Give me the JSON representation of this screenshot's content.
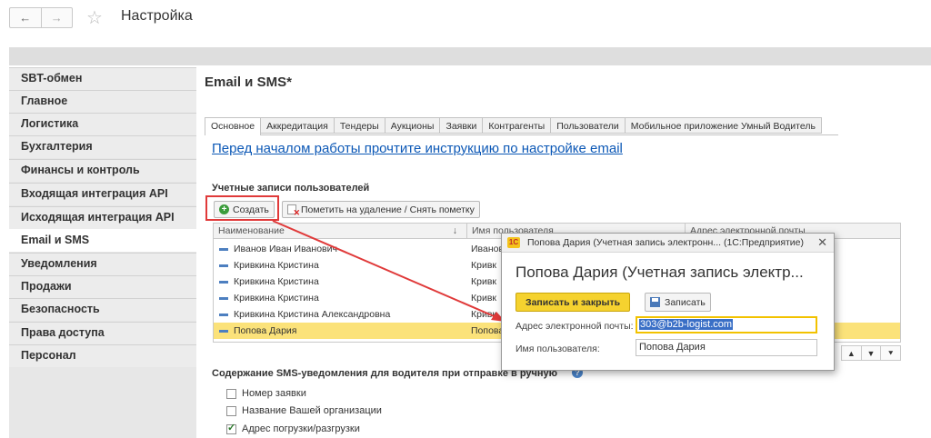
{
  "header": {
    "title": "Настройка",
    "back_glyph": "←",
    "forward_glyph": "→",
    "favorite_glyph": "☆"
  },
  "sidebar": {
    "items": [
      {
        "label": "SBT-обмен"
      },
      {
        "label": "Главное"
      },
      {
        "label": "Логистика"
      },
      {
        "label": "Бухгалтерия"
      },
      {
        "label": "Финансы и контроль"
      },
      {
        "label": "Входящая интеграция API"
      },
      {
        "label": "Исходящая интеграция API"
      },
      {
        "label": "Email и SMS",
        "active": true
      },
      {
        "label": "Уведомления"
      },
      {
        "label": "Продажи"
      },
      {
        "label": "Безопасность"
      },
      {
        "label": "Права доступа"
      },
      {
        "label": "Персонал"
      }
    ]
  },
  "main": {
    "title": "Email и SMS*",
    "tabs": [
      "Основное",
      "Аккредитация",
      "Тендеры",
      "Аукционы",
      "Заявки",
      "Контрагенты",
      "Пользователи",
      "Мобильное приложение Умный Водитель"
    ],
    "instruction_link": "Перед началом работы прочтите инструкцию по настройке email",
    "accounts_label": "Учетные записи пользователей",
    "create_button": "Создать",
    "mark_delete_button": "Пометить на удаление / Снять пометку",
    "table": {
      "columns": [
        "Наименование",
        "Имя пользователя",
        "Адрес электронной почты"
      ],
      "sort_glyph": "↓",
      "rows": [
        {
          "name": "Иванов Иван Иванович",
          "user": "Иванов"
        },
        {
          "name": "Кривкина Кристина",
          "user": "Кривк"
        },
        {
          "name": "Кривкина Кристина",
          "user": "Кривк"
        },
        {
          "name": "Кривкина Кристина",
          "user": "Кривк"
        },
        {
          "name": "Кривкина Кристина Александровна",
          "user": "Кривк"
        },
        {
          "name": "Попова Дария",
          "user": "Попова",
          "selected": true
        }
      ],
      "nav_glyphs": [
        "▲",
        "▼",
        "⯆"
      ]
    },
    "sms_label": "Содержание SMS-уведомления для водителя при отправке в ручную",
    "help_glyph": "?",
    "checkboxes": [
      {
        "label": "Номер заявки",
        "checked": false
      },
      {
        "label": "Название Вашей организации",
        "checked": false
      },
      {
        "label": "Адрес погрузки/разгрузки",
        "checked": true
      }
    ]
  },
  "popup": {
    "logo": "1С",
    "title": "Попова Дария (Учетная запись электронн... (1С:Предприятие)",
    "close_glyph": "✕",
    "heading": "Попова Дария (Учетная запись электр...",
    "save_close_button": "Записать и закрыть",
    "save_button": "Записать",
    "email_label": "Адрес электронной почты:",
    "email_value": "303@b2b-logist.com",
    "user_label": "Имя пользователя:",
    "user_value": "Попова Дария"
  },
  "colors": {
    "accent_yellow": "#f5d22f",
    "link_blue": "#0c58b6",
    "highlight_red": "#e03a3a",
    "selected_row": "#fbe27a"
  }
}
